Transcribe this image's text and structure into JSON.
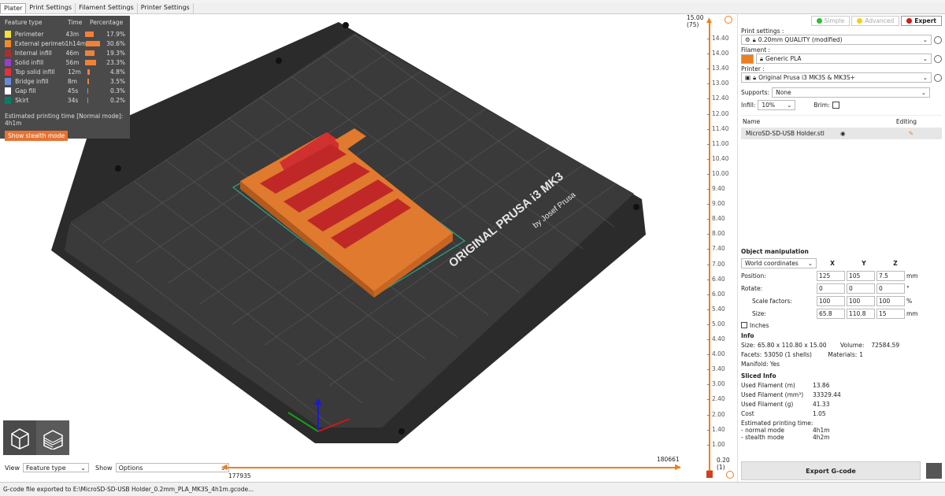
{
  "tabs": [
    "Plater",
    "Print Settings",
    "Filament Settings",
    "Printer Settings"
  ],
  "legend": {
    "headers": [
      "Feature type",
      "Time",
      "Percentage"
    ],
    "rows": [
      {
        "name": "Perimeter",
        "time": "43m",
        "pct": "17.9%",
        "frac": 0.179,
        "color": "#f5e03c"
      },
      {
        "name": "External perimeter",
        "time": "1h14m",
        "pct": "30.6%",
        "frac": 0.306,
        "color": "#f08a2b"
      },
      {
        "name": "Internal infill",
        "time": "46m",
        "pct": "19.3%",
        "frac": 0.193,
        "color": "#a83030"
      },
      {
        "name": "Solid infill",
        "time": "56m",
        "pct": "23.3%",
        "frac": 0.233,
        "color": "#9a3bd1"
      },
      {
        "name": "Top solid infill",
        "time": "12m",
        "pct": "4.8%",
        "frac": 0.048,
        "color": "#e8303a"
      },
      {
        "name": "Bridge infill",
        "time": "8m",
        "pct": "3.5%",
        "frac": 0.035,
        "color": "#6b8ad6"
      },
      {
        "name": "Gap fill",
        "time": "45s",
        "pct": "0.3%",
        "frac": 0.003,
        "color": "#ffffff"
      },
      {
        "name": "Skirt",
        "time": "34s",
        "pct": "0.2%",
        "frac": 0.002,
        "color": "#00806b"
      }
    ],
    "estimated": "Estimated printing time [Normal mode]:  4h1m",
    "stealth_button": "Show stealth mode"
  },
  "bed": {
    "brand": "ORIGINAL PRUSA i3  MK3",
    "byline": "by Josef Prusa"
  },
  "layer_slider": {
    "top_value": "15.00",
    "top_layer": "(75)",
    "bottom_value": "0.20",
    "bottom_layer": "(1)",
    "ticks": [
      "14.40",
      "14.00",
      "13.40",
      "13.00",
      "12.40",
      "12.00",
      "11.40",
      "11.00",
      "10.40",
      "10.00",
      "9.40",
      "9.00",
      "8.40",
      "8.00",
      "7.40",
      "7.00",
      "6.40",
      "6.00",
      "5.40",
      "5.00",
      "4.40",
      "4.00",
      "3.40",
      "3.00",
      "2.40",
      "2.00",
      "1.40",
      "1.00"
    ]
  },
  "horizontal_slider": {
    "right_value": "180661",
    "left_value": "177935"
  },
  "bottom": {
    "view_label": "View",
    "view_value": "Feature type",
    "show_label": "Show",
    "show_value": "Options"
  },
  "panel": {
    "modes": [
      {
        "label": "Simple",
        "color": "#2fbf2f"
      },
      {
        "label": "Advanced",
        "color": "#f0d020"
      },
      {
        "label": "Expert",
        "color": "#d01818"
      }
    ],
    "print_settings_label": "Print settings :",
    "print_settings_value": "0.20mm QUALITY (modified)",
    "filament_label": "Filament :",
    "filament_value": "Generic PLA",
    "filament_color": "#f07e1e",
    "printer_label": "Printer :",
    "printer_value": "Original Prusa i3 MK3S & MK3S+",
    "supports_label": "Supports:",
    "supports_value": "None",
    "infill_label": "Infill:",
    "infill_value": "10%",
    "brim_label": "Brim:",
    "objects_name_header": "Name",
    "objects_editing_header": "Editing",
    "object_name": "MicroSD-SD-USB Holder.stl",
    "manip_title": "Object manipulation",
    "coord_system": "World coordinates",
    "axes": [
      "X",
      "Y",
      "Z"
    ],
    "position_label": "Position:",
    "position": [
      "125",
      "105",
      "7.5"
    ],
    "position_unit": "mm",
    "rotate_label": "Rotate:",
    "rotate": [
      "0",
      "0",
      "0"
    ],
    "rotate_unit": "°",
    "scale_label": "Scale factors:",
    "scale": [
      "100",
      "100",
      "100"
    ],
    "scale_unit": "%",
    "size_label": "Size:",
    "size": [
      "65.8",
      "110.8",
      "15"
    ],
    "size_unit": "mm",
    "inches_label": "Inches",
    "info_title": "Info",
    "info_size_label": "Size:",
    "info_size": "65.80 x 110.80 x 15.00",
    "volume_label": "Volume:",
    "volume": "72584.59",
    "facets_label": "Facets:",
    "facets": "53050 (1 shells)",
    "materials_label": "Materials:",
    "materials": "1",
    "manifold": "Manifold: Yes",
    "sliced_title": "Sliced Info",
    "used_m_label": "Used Filament (m)",
    "used_m": "13.86",
    "used_mm3_label": "Used Filament (mm³)",
    "used_mm3": "33329.44",
    "used_g_label": "Used Filament (g)",
    "used_g": "41.33",
    "cost_label": "Cost",
    "cost": "1.05",
    "est_label": "Estimated printing time:",
    "normal_label": "- normal mode",
    "normal": "4h1m",
    "stealth_label": "- stealth mode",
    "stealth": "4h2m",
    "export_button": "Export G-code"
  },
  "status": "G-code file exported to E:\\MicroSD-SD-USB Holder_0.2mm_PLA_MK3S_4h1m.gcode..."
}
